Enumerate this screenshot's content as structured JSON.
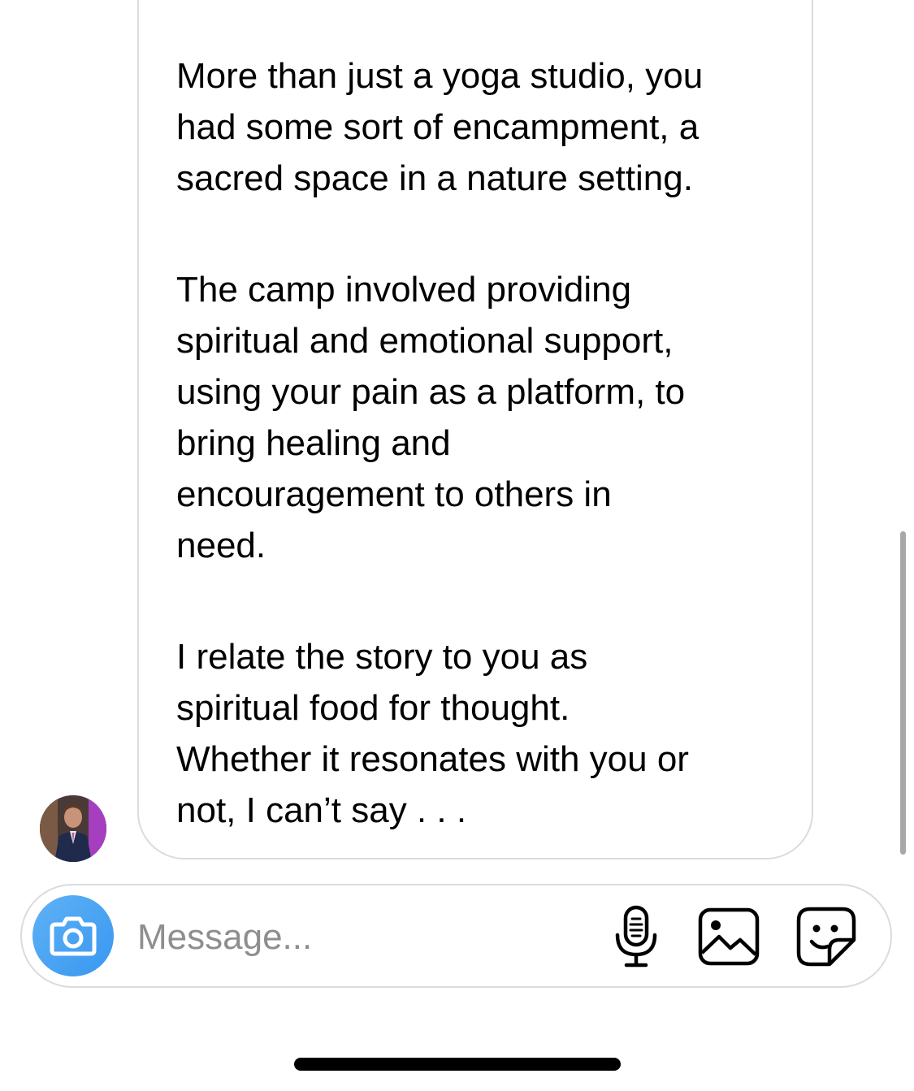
{
  "message": {
    "paragraphs": [
      "More than just a yoga studio, you\nhad some sort of encampment, a\nsacred space in a nature setting.",
      "The camp involved providing\nspiritual and emotional support,\nusing your pain as a platform, to\nbring healing and\nencouragement to others in\nneed.",
      "I relate the story to you as\nspiritual food for thought.\nWhether it resonates with you or\nnot, I can’t say . . ."
    ]
  },
  "composer": {
    "placeholder": "Message...",
    "icons": [
      "camera-icon",
      "microphone-icon",
      "gallery-icon",
      "sticker-icon"
    ]
  },
  "colors": {
    "accent": "#3897f0",
    "border": "#dbdbdb",
    "placeholder": "#8e8e8e"
  }
}
